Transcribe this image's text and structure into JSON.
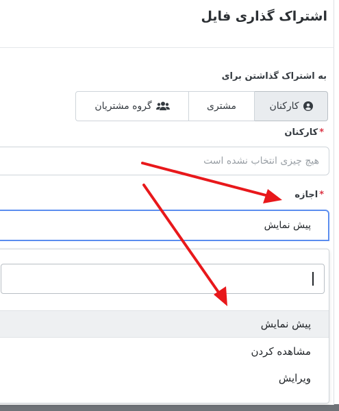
{
  "modal": {
    "title": "اشتراک گذاری فایل"
  },
  "share_with": {
    "label": "به اشتراک گذاشتن برای",
    "options": [
      {
        "label": "کارکنان",
        "icon": "user-circle-icon",
        "active": true
      },
      {
        "label": "مشتری",
        "icon": "",
        "active": false
      },
      {
        "label": "گروه مشتریان",
        "icon": "users-group-icon",
        "active": false
      }
    ]
  },
  "staff_field": {
    "label": "کارکنان",
    "required_mark": "*",
    "placeholder": "هیچ چیزی انتخاب نشده است"
  },
  "permission_field": {
    "label": "اجازه",
    "required_mark": "*",
    "value": "پیش نمایش"
  },
  "permission_dropdown": {
    "search_value": "",
    "options": [
      "پیش نمایش",
      "مشاهده کردن",
      "ویرایش"
    ],
    "highlighted_index": 0
  },
  "annotation_color": "#e8181b"
}
